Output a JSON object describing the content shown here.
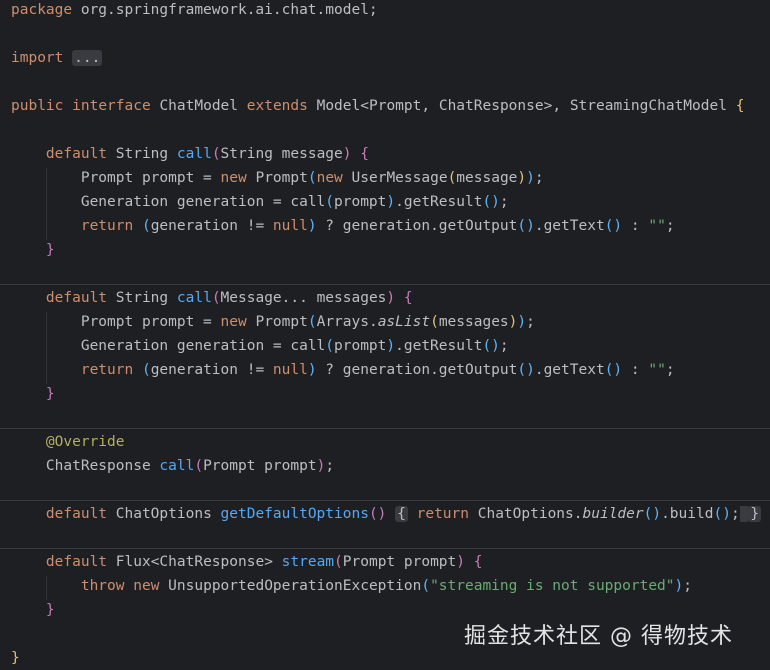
{
  "code": {
    "package_kw": "package",
    "package_name": " org.springframework.ai.chat.model;",
    "import_kw": "import",
    "import_fold": "...",
    "public_kw": "public",
    "interface_kw": "interface",
    "class_name": "ChatModel",
    "extends_kw": "extends",
    "model": "Model",
    "prompt_type": "Prompt",
    "chat_response_type": "ChatResponse",
    "streaming_model": "StreamingChatModel",
    "default_kw": "default",
    "string_type": "String",
    "call_fn": "call",
    "param_message": "String message",
    "prompt_decl": "Prompt prompt = ",
    "new_kw": "new",
    "user_message": "UserMessage",
    "message_arg": "message",
    "generation_decl": "Generation generation = call",
    "prompt_arg": "prompt",
    "get_result": ".getResult",
    "return_kw": "return",
    "generation_check": "generation != ",
    "null_kw": "null",
    "ternary": " ? generation.getOutput",
    "get_text": ".getText",
    "colon": " : ",
    "empty_string": "\"\"",
    "param_messages": "Message... messages",
    "arrays": "Arrays.",
    "as_list": "asList",
    "messages_arg": "messages",
    "override": "@Override",
    "chat_response_call": "ChatResponse ",
    "param_prompt": "Prompt prompt",
    "chat_options": "ChatOptions ",
    "get_default_options": "getDefaultOptions",
    "chat_options_ref": "ChatOptions.",
    "builder": "builder",
    "build": ".build",
    "flux": "Flux",
    "stream_fn": "stream",
    "throw_kw": "throw",
    "unsupported_exc": "UnsupportedOperationException",
    "streaming_msg": "\"streaming is not supported\""
  },
  "watermark": "掘金技术社区 @ 得物技术"
}
